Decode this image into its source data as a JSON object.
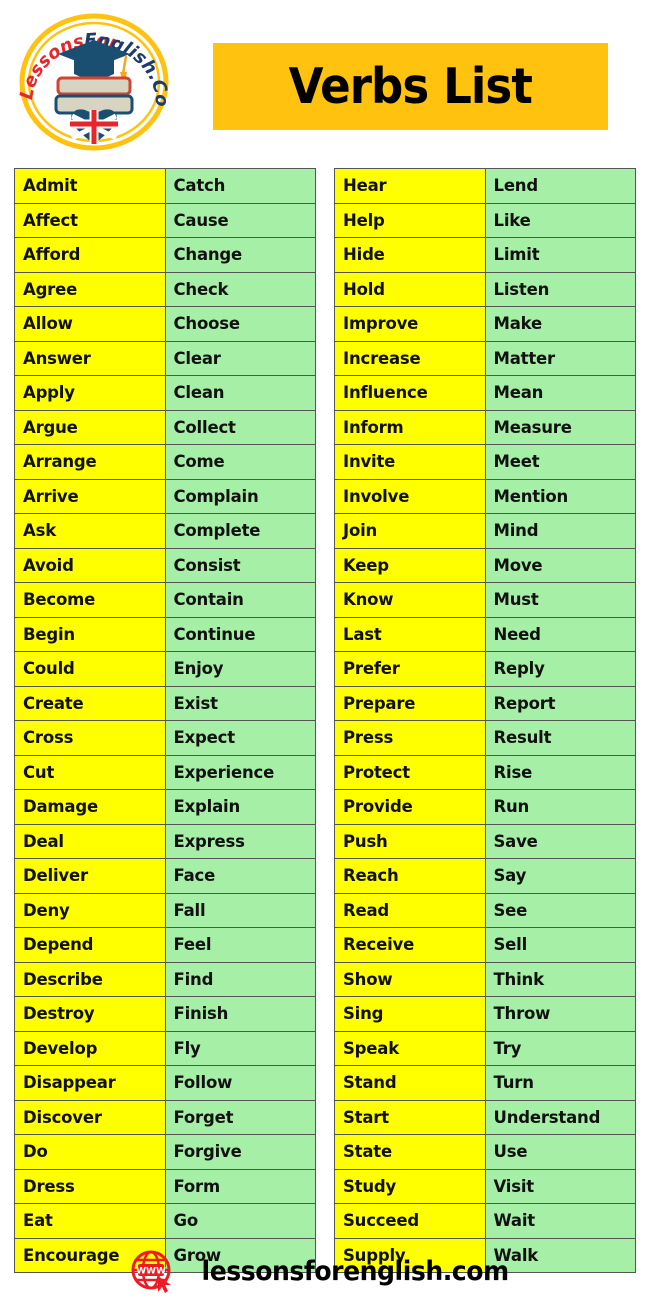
{
  "header": {
    "title": "Verbs List",
    "logo_alt": "LessonsForEnglish.Com",
    "logo_text_top": "LessonsFor",
    "logo_text_bottom": "English.Com",
    "banner_color": "#ffc20e"
  },
  "colors": {
    "yellow_cell": "#ffff00",
    "green_cell": "#a6efa6",
    "border": "#555555",
    "logo_ring": "#ffc20e",
    "logo_red": "#e8252a",
    "logo_blue": "#1b4f72"
  },
  "tables": [
    {
      "name": "left-table",
      "rows": [
        [
          "Admit",
          "Catch"
        ],
        [
          "Affect",
          "Cause"
        ],
        [
          "Afford",
          "Change"
        ],
        [
          "Agree",
          "Check"
        ],
        [
          "Allow",
          "Choose"
        ],
        [
          "Answer",
          "Clear"
        ],
        [
          "Apply",
          "Clean"
        ],
        [
          "Argue",
          "Collect"
        ],
        [
          "Arrange",
          "Come"
        ],
        [
          "Arrive",
          "Complain"
        ],
        [
          "Ask",
          "Complete"
        ],
        [
          "Avoid",
          "Consist"
        ],
        [
          "Become",
          "Contain"
        ],
        [
          "Begin",
          "Continue"
        ],
        [
          "Could",
          "Enjoy"
        ],
        [
          "Create",
          "Exist"
        ],
        [
          "Cross",
          "Expect"
        ],
        [
          "Cut",
          "Experience"
        ],
        [
          "Damage",
          "Explain"
        ],
        [
          "Deal",
          "Express"
        ],
        [
          "Deliver",
          "Face"
        ],
        [
          "Deny",
          "Fall"
        ],
        [
          "Depend",
          "Feel"
        ],
        [
          "Describe",
          "Find"
        ],
        [
          "Destroy",
          "Finish"
        ],
        [
          "Develop",
          "Fly"
        ],
        [
          "Disappear",
          "Follow"
        ],
        [
          "Discover",
          "Forget"
        ],
        [
          "Do",
          "Forgive"
        ],
        [
          "Dress",
          "Form"
        ],
        [
          "Eat",
          "Go"
        ],
        [
          "Encourage",
          "Grow"
        ]
      ]
    },
    {
      "name": "right-table",
      "rows": [
        [
          "Hear",
          "Lend"
        ],
        [
          "Help",
          "Like"
        ],
        [
          "Hide",
          "Limit"
        ],
        [
          "Hold",
          "Listen"
        ],
        [
          "Improve",
          "Make"
        ],
        [
          "Increase",
          "Matter"
        ],
        [
          "Influence",
          "Mean"
        ],
        [
          "Inform",
          "Measure"
        ],
        [
          "Invite",
          "Meet"
        ],
        [
          "Involve",
          "Mention"
        ],
        [
          "Join",
          "Mind"
        ],
        [
          "Keep",
          "Move"
        ],
        [
          "Know",
          "Must"
        ],
        [
          "Last",
          "Need"
        ],
        [
          "Prefer",
          "Reply"
        ],
        [
          "Prepare",
          "Report"
        ],
        [
          "Press",
          "Result"
        ],
        [
          "Protect",
          "Rise"
        ],
        [
          "Provide",
          "Run"
        ],
        [
          "Push",
          "Save"
        ],
        [
          "Reach",
          "Say"
        ],
        [
          "Read",
          "See"
        ],
        [
          "Receive",
          "Sell"
        ],
        [
          "Show",
          "Think"
        ],
        [
          "Sing",
          "Throw"
        ],
        [
          "Speak",
          "Try"
        ],
        [
          "Stand",
          "Turn"
        ],
        [
          "Start",
          "Understand"
        ],
        [
          "State",
          "Use"
        ],
        [
          "Study",
          "Visit"
        ],
        [
          "Succeed",
          "Wait"
        ],
        [
          "Supply",
          "Walk"
        ]
      ]
    }
  ],
  "footer": {
    "site": "lessonsforenglish.com",
    "icon": "globe-www-cursor-icon"
  }
}
